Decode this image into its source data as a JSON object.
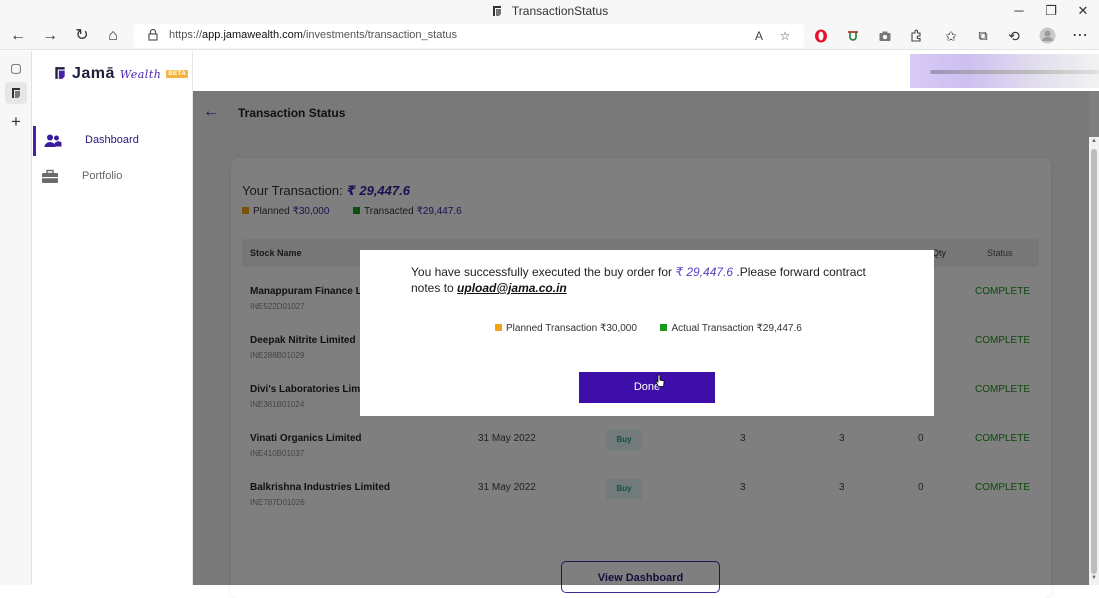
{
  "browser": {
    "tab_title": "TransactionStatus",
    "url_prefix": "https://",
    "url_host": "app.jamawealth.com",
    "url_path": "/investments/transaction_status",
    "win_minimize": "─",
    "win_restore": "❐",
    "win_close": "✕",
    "icons": {
      "back": "←",
      "forward": "→",
      "refresh": "↻",
      "home": "⌂",
      "read_aloud": "A",
      "favorite_add": "☆",
      "favorites": "✩",
      "collections": "⧉",
      "history": "⟲",
      "more": "⋯",
      "new_tab": "+",
      "tab_actions": "▢"
    }
  },
  "sidebar": {
    "logo_text": "Jamā",
    "logo_script": "Wealth",
    "logo_badge": "BETA",
    "items": [
      {
        "label": "Dashboard",
        "icon": "users-icon",
        "active": true
      },
      {
        "label": "Portfolio",
        "icon": "briefcase-icon",
        "active": false
      }
    ]
  },
  "page": {
    "title": "Transaction Status",
    "back_icon": "←"
  },
  "summary": {
    "label": "Your Transaction:",
    "amount": "₹ 29,447.6",
    "planned_label": "Planned",
    "planned_value": "₹30,000",
    "transacted_label": "Transacted",
    "transacted_value": "₹29,447.6"
  },
  "table": {
    "headers": {
      "stock_name": "Stock Name",
      "qty": "Qty",
      "status": "Status"
    },
    "rows": [
      {
        "name": "Manappuram Finance L",
        "isin": "INE522D01027",
        "date": "",
        "type": "",
        "q1": "",
        "q2": "",
        "q3": "",
        "status": "COMPLETE"
      },
      {
        "name": "Deepak Nitrite Limited",
        "isin": "INE288B01029",
        "date": "",
        "type": "",
        "q1": "",
        "q2": "",
        "q3": "",
        "status": "COMPLETE"
      },
      {
        "name": "Divi's Laboratories Limi",
        "isin": "INE361B01024",
        "date": "",
        "type": "",
        "q1": "",
        "q2": "",
        "q3": "",
        "status": "COMPLETE"
      },
      {
        "name": "Vinati Organics Limited",
        "isin": "INE410B01037",
        "date": "31 May 2022",
        "type": "Buy",
        "q1": "3",
        "q2": "3",
        "q3": "0",
        "status": "COMPLETE"
      },
      {
        "name": "Balkrishna Industries Limited",
        "isin": "INE787D01026",
        "date": "31 May 2022",
        "type": "Buy",
        "q1": "3",
        "q2": "3",
        "q3": "0",
        "status": "COMPLETE"
      }
    ]
  },
  "view_dashboard_label": "View Dashboard",
  "modal": {
    "msg_prefix": "You have successfully executed the buy order for",
    "msg_amount": "₹ 29,447.6",
    "msg_middle": " .Please forward contract notes to",
    "email": "upload@jama.co.in",
    "planned_label": "Planned Transaction",
    "planned_value": "₹30,000",
    "actual_label": "Actual Transaction",
    "actual_value": "₹29,447.6",
    "done_label": "Done"
  },
  "colors": {
    "brand": "#4b1fa8",
    "done_button": "#3e0fa8",
    "planned_legend": "#f2a511",
    "transacted_legend": "#1a9a1a",
    "status_complete": "#1a8f1a"
  }
}
